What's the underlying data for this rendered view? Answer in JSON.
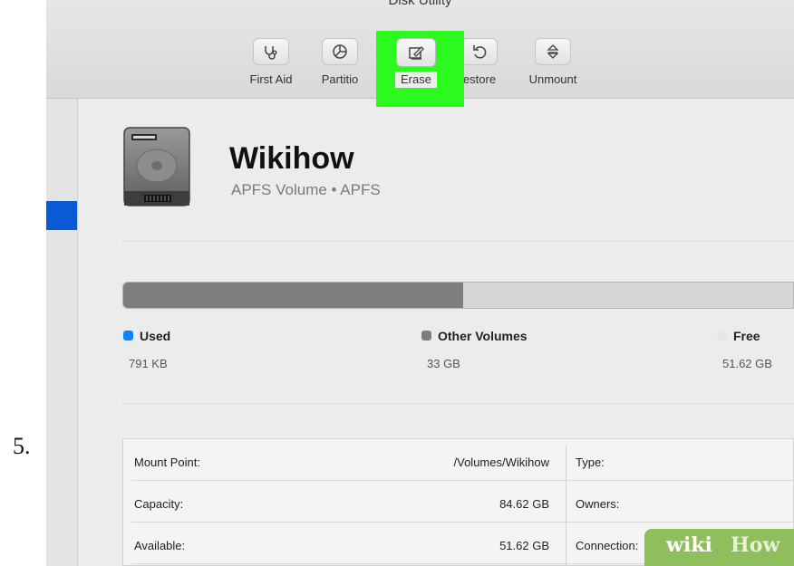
{
  "step_label": "5.",
  "window": {
    "title": "Disk Utility"
  },
  "toolbar": {
    "first_aid": {
      "label": "First Aid",
      "icon": "stethoscope-icon"
    },
    "partition": {
      "label": "Partitio",
      "icon": "pie-chart-icon"
    },
    "erase": {
      "label": "Erase",
      "icon": "erase-icon"
    },
    "restore": {
      "label": "estore",
      "icon": "restore-arrow-icon"
    },
    "unmount": {
      "label": "Unmount",
      "icon": "eject-icon"
    }
  },
  "highlight_color": "#2cfa1f",
  "selected_color": "#0a5bd3",
  "volume": {
    "name": "Wikihow",
    "subtitle": "APFS Volume • APFS",
    "icon": "hard-drive-icon"
  },
  "usage": {
    "used_fraction": 0.0,
    "other_fraction": 0.507,
    "colors": {
      "used": "#0a84ff",
      "other": "#7e7e7e",
      "free": "#d6d6d6"
    },
    "legend": [
      {
        "name": "Used",
        "value": "791 KB"
      },
      {
        "name": "Other Volumes",
        "value": "33 GB"
      },
      {
        "name": "Free",
        "value": "51.62 GB"
      }
    ]
  },
  "info": {
    "rows": [
      {
        "key": "Mount Point:",
        "value": "/Volumes/Wikihow",
        "key2": "Type:"
      },
      {
        "key": "Capacity:",
        "value": "84.62 GB",
        "key2": "Owners:"
      },
      {
        "key": "Available:",
        "value": "51.62 GB",
        "key2": "Connection:"
      }
    ]
  },
  "watermark": {
    "part1": "wiki",
    "part2": "How"
  }
}
